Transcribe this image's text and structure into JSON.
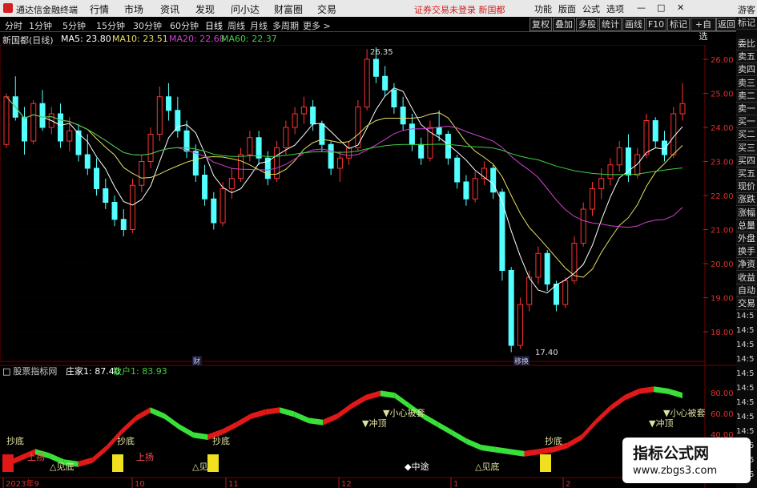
{
  "menubar": {
    "app_title": "通达信金融终端",
    "items": [
      "行情",
      "市场",
      "资讯",
      "发现",
      "问小达",
      "财富圈",
      "交易"
    ],
    "notice": "证券交易未登录",
    "notice_stock": "新国都",
    "right_items": [
      "功能",
      "版面",
      "公式",
      "选项"
    ],
    "guest": "游客"
  },
  "toolbar": {
    "periods": [
      "分时",
      "1分钟",
      "5分钟",
      "15分钟",
      "30分钟",
      "60分钟",
      "日线",
      "周线",
      "月线",
      "多周期",
      "更多 >"
    ],
    "active_period": "日线",
    "right_buttons": [
      "复权",
      "叠加",
      "多股",
      "统计",
      "画线",
      "F10",
      "标记",
      "+自选",
      "返回"
    ]
  },
  "ma_legend": {
    "title": "新国都(日线)",
    "ma5": "MA5: 23.80",
    "ma10": "MA10: 23.51",
    "ma20": "MA20: 22.68",
    "ma60": "MA60: 22.37",
    "colors": {
      "ma5": "#ffffff",
      "ma10": "#e8e060",
      "ma20": "#d040d0",
      "ma60": "#40d040"
    }
  },
  "price_axis": {
    "labels": [
      "26.00",
      "25.00",
      "24.00",
      "23.00",
      "22.00",
      "21.00",
      "20.00",
      "19.00",
      "18.00"
    ],
    "high_marker": "26.35",
    "low_marker": "17.40",
    "event_tag_finance": "财",
    "event_tag_report": "移换"
  },
  "indicator": {
    "name": "股票指标网",
    "zhuangjia": "庄家1: 87.40",
    "sanhu": "散户1: 83.93",
    "axis_labels": [
      "80.00",
      "60.00",
      "40.00",
      "20.00"
    ],
    "signals": {
      "chaodi": "抄底",
      "jiandi": "△见底",
      "shangyang": "上扬",
      "xiaoxin": "▼小心被套",
      "chongding": "▼冲顶",
      "zhongtu": "◆中途"
    }
  },
  "date_axis": {
    "labels": [
      "2023年9",
      "10",
      "11",
      "12",
      "1",
      "2"
    ]
  },
  "side_panel": {
    "top_label": "标记",
    "items": [
      "委比",
      "卖五",
      "卖四",
      "卖三",
      "卖二",
      "卖一",
      "买一",
      "买二",
      "买三",
      "买四",
      "买五",
      "现价",
      "涨跌",
      "涨幅",
      "总量",
      "外盘",
      "换手",
      "净资",
      "收益",
      "自动",
      "交易"
    ],
    "times": [
      "14:5",
      "14:5",
      "14:5",
      "14:5",
      "14:5",
      "14:5",
      "14:5",
      "14:5",
      "14:5",
      "14:5",
      "14:5",
      "14:5"
    ]
  },
  "watermark": {
    "title": "指标公式网",
    "url": "www.zbgs3.com"
  }
}
